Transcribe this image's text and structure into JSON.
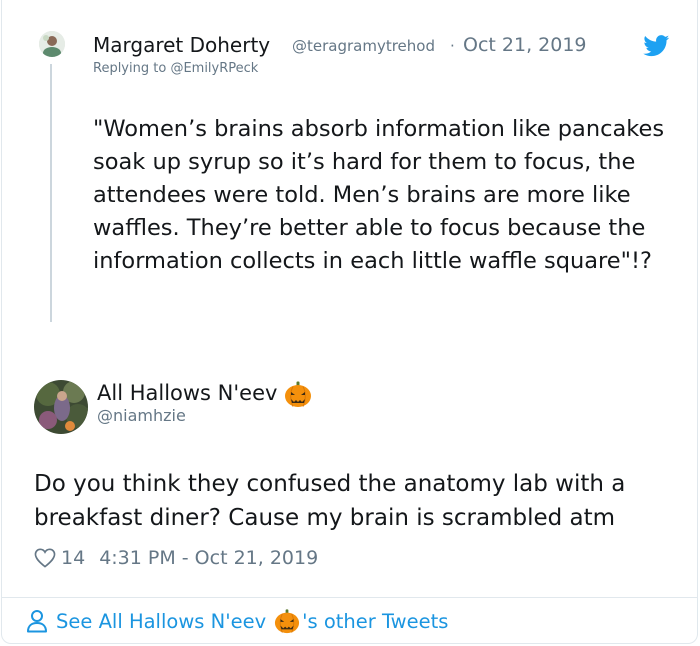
{
  "parent_tweet": {
    "author_name": "Margaret Doherty",
    "author_handle": "@teragramytrehod",
    "separator": "·",
    "date": "Oct 21, 2019",
    "reply_prefix": "Replying to",
    "reply_to_handle": "@EmilyRPeck",
    "text": "\"Women’s brains absorb information like pancakes soak up syrup so it’s hard for them to focus, the attendees were told. Men’s brains are more like waffles. They’re better able to focus because the information collects in each little waffle square\"!?"
  },
  "main_tweet": {
    "author_name": "All Hallows N'eev",
    "author_handle": "@niamhzie",
    "text": "Do you think they confused the anatomy lab with a breakfast diner? Cause my brain is scrambled atm",
    "like_count": "14",
    "timestamp": "4:31 PM - Oct 21, 2019"
  },
  "footer": {
    "prefix": "See All Hallows N'eev",
    "suffix": "'s other Tweets"
  },
  "icons": {
    "twitter": "twitter-bird-icon",
    "like": "heart-icon",
    "profile": "person-icon",
    "emoji": "pumpkin-icon"
  },
  "colors": {
    "brand_blue": "#1da1f2",
    "link_blue": "#1b95e0",
    "secondary_text": "#657786",
    "primary_text": "#14171a",
    "pumpkin": "#f4900c"
  }
}
